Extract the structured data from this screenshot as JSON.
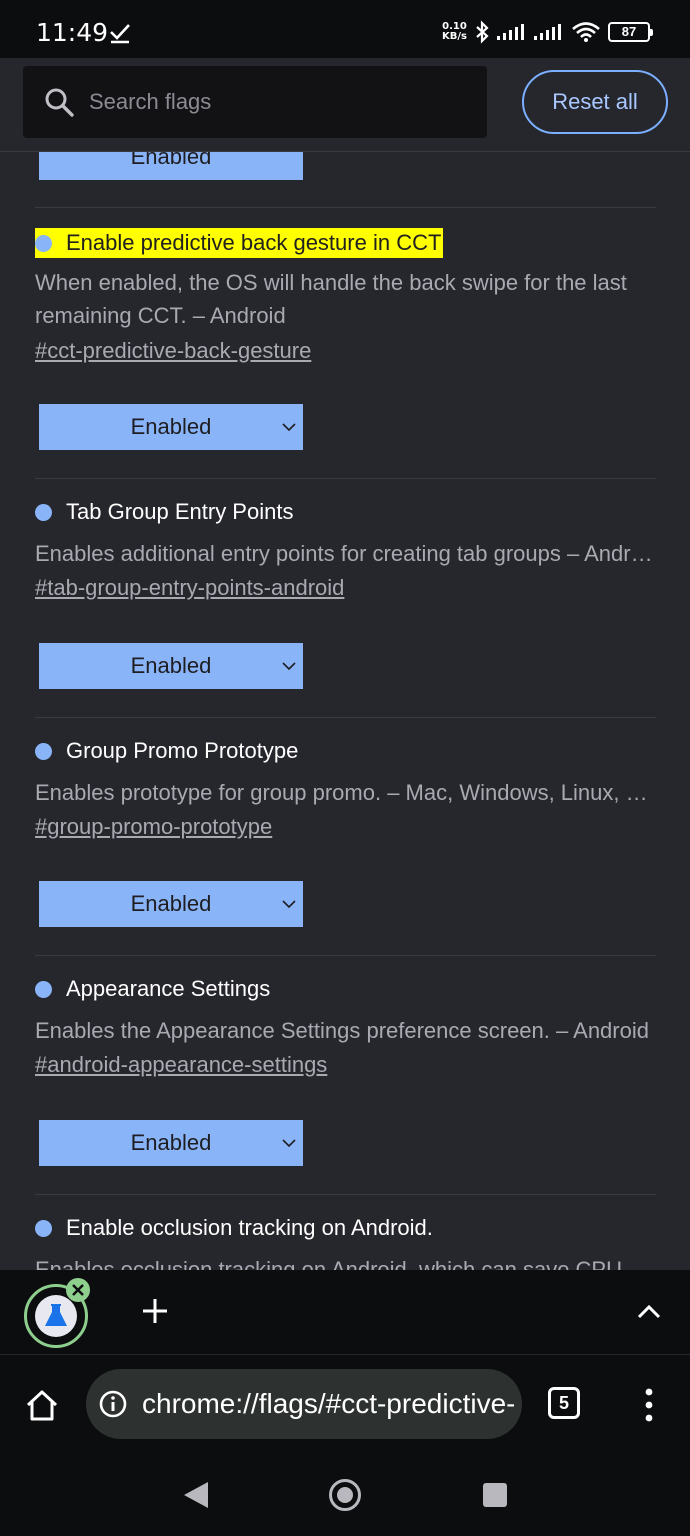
{
  "status_bar": {
    "time": "11:49",
    "net_speed_value": "0.10",
    "net_speed_unit": "KB/s",
    "battery": "87"
  },
  "header": {
    "search_placeholder": "Search flags",
    "reset_label": "Reset all"
  },
  "partial_flag": {
    "select_value": "Enabled"
  },
  "flags": [
    {
      "title": "Enable predictive back gesture in CCT",
      "description": "When enabled, the OS will handle the back swipe for the last remaining CCT. – Android",
      "link": "#cct-predictive-back-gesture",
      "select_value": "Enabled"
    },
    {
      "title": "Tab Group Entry Points",
      "description": "Enables additional entry points for creating tab groups – Android",
      "link": "#tab-group-entry-points-android",
      "select_value": "Enabled"
    },
    {
      "title": "Group Promo Prototype",
      "description": "Enables prototype for group promo. – Mac, Windows, Linux, ChromeOS",
      "link": "#group-promo-prototype",
      "select_value": "Enabled"
    },
    {
      "title": "Appearance Settings",
      "description": "Enables the Appearance Settings preference screen. – Android",
      "link": "#android-appearance-settings",
      "select_value": "Enabled"
    },
    {
      "title": "Enable occlusion tracking on Android.",
      "description": "Enables occlusion tracking on Android, which can save CPU"
    }
  ],
  "toolbar": {
    "url": "chrome://flags/#cct-predictive-back-gesture",
    "tab_count": "5"
  },
  "colors": {
    "accent": "#8ab4f8",
    "highlight": "#ffff00",
    "background": "#26262d"
  }
}
